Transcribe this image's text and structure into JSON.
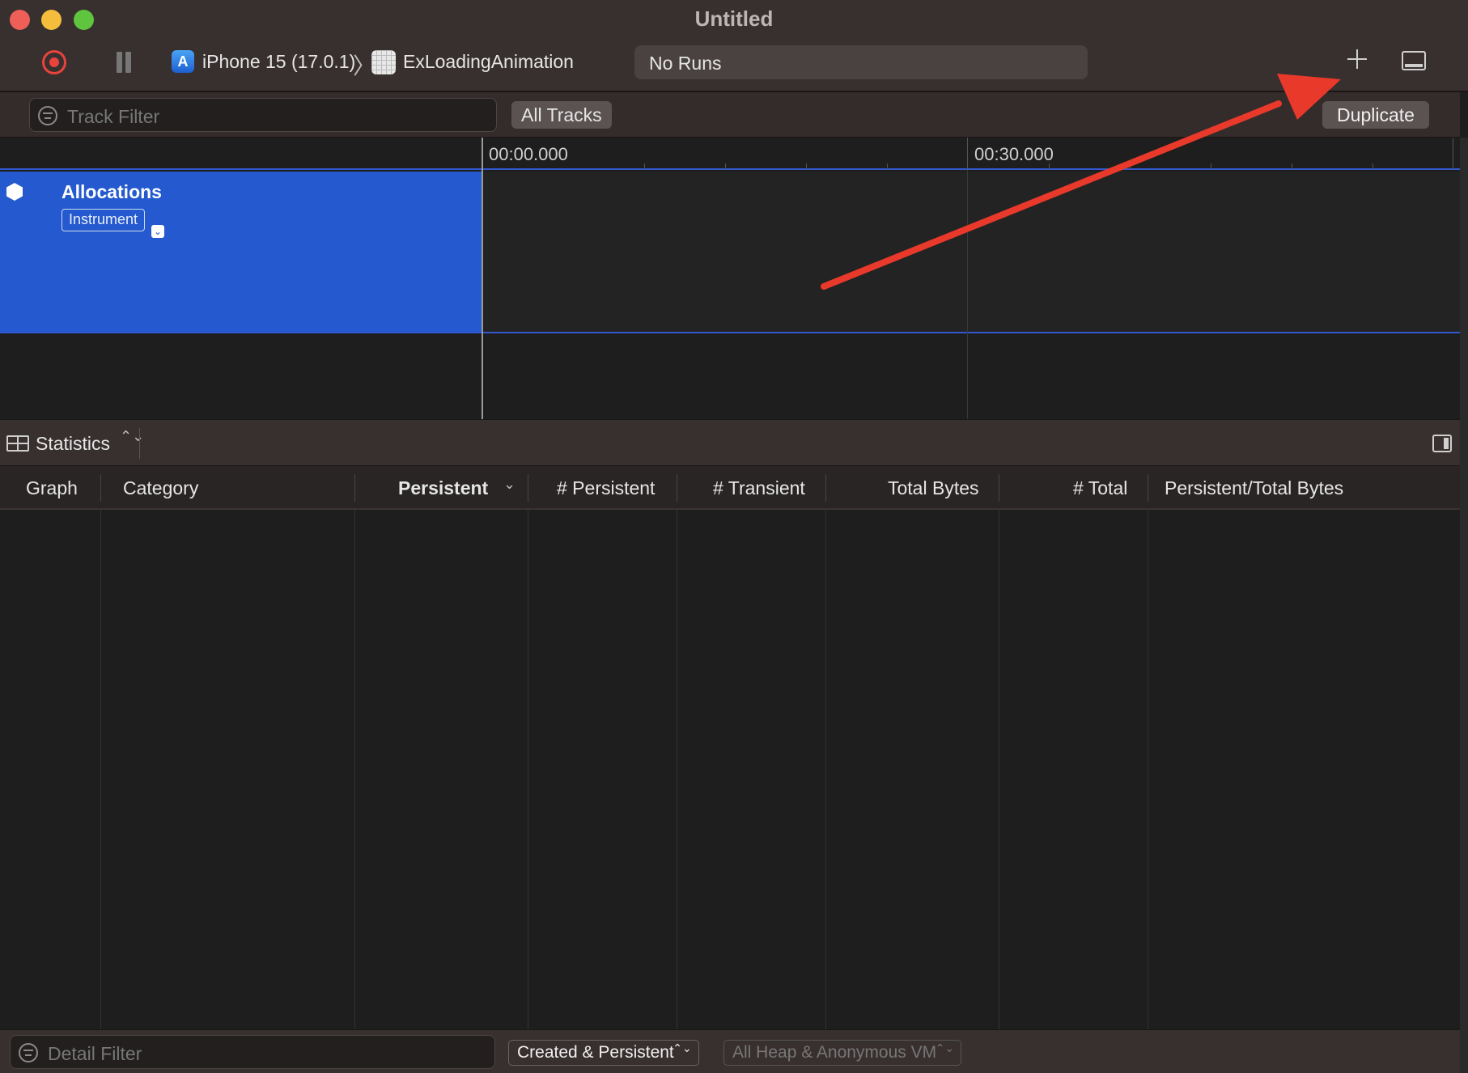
{
  "window": {
    "title": "Untitled"
  },
  "toolbar": {
    "device": "iPhone 15 (17.0.1)",
    "separator": "〉",
    "target": "ExLoadingAnimation",
    "runs": "No Runs",
    "app_icon_glyph": "A"
  },
  "filters": {
    "track_filter_placeholder": "Track Filter",
    "all_tracks": "All Tracks",
    "duplicate": "Duplicate"
  },
  "timeline": {
    "tick_labels": [
      "00:00.000",
      "00:30.000"
    ],
    "track": {
      "title": "Allocations",
      "badge": "Instrument",
      "badge_chevron": "⌄"
    }
  },
  "stats": {
    "view_label": "Statistics",
    "updown": "⌃⌄"
  },
  "table": {
    "columns": [
      "Graph",
      "Category",
      "Persistent",
      "# Persistent",
      "# Transient",
      "Total Bytes",
      "# Total",
      "Persistent/Total Bytes"
    ],
    "sorted_column": "Persistent",
    "sort_indicator": "⌄",
    "rows": []
  },
  "bottom": {
    "detail_filter_placeholder": "Detail Filter",
    "mode_popup": "Created & Persistent",
    "heap_popup": "All Heap & Anonymous VM",
    "updown": "⌃⌄"
  },
  "colors": {
    "record": "#e8433c",
    "track_selected": "#2459cf",
    "annotation_arrow": "#e8392b"
  },
  "icons": {
    "record": "record-icon",
    "pause": "pause-icon",
    "add": "plus-icon",
    "panel": "bottom-panel-icon",
    "filter": "filter-icon",
    "track": "cube-icon",
    "stats": "table-grid-icon",
    "inspector": "inspector-icon"
  }
}
